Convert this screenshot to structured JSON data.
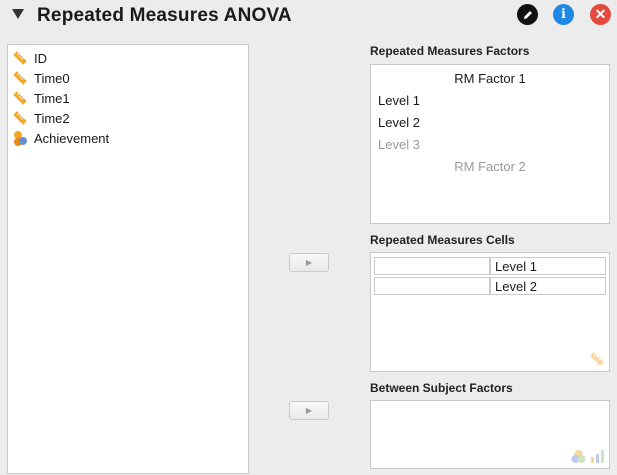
{
  "header": {
    "title": "Repeated Measures ANOVA",
    "buttons": [
      {
        "name": "edit-title",
        "icon": "pencil-icon",
        "color": "#111111"
      },
      {
        "name": "info",
        "icon": "info-icon",
        "color": "#1e88e5"
      },
      {
        "name": "close",
        "icon": "close-icon",
        "color": "#e4493d"
      }
    ]
  },
  "variables": [
    {
      "label": "ID",
      "icon": "scale-ruler-icon"
    },
    {
      "label": "Time0",
      "icon": "scale-ruler-icon"
    },
    {
      "label": "Time1",
      "icon": "scale-ruler-icon"
    },
    {
      "label": "Time2",
      "icon": "scale-ruler-icon"
    },
    {
      "label": "Achievement",
      "icon": "nominal-variable-icon"
    }
  ],
  "rm_factors": {
    "label": "Repeated Measures Factors",
    "factor1": "RM Factor 1",
    "levels": [
      "Level 1",
      "Level 2"
    ],
    "level_placeholder": "Level 3",
    "factor2_placeholder": "RM Factor 2"
  },
  "rm_cells": {
    "label": "Repeated Measures Cells",
    "rows": [
      {
        "variable": "",
        "level": "Level 1"
      },
      {
        "variable": "",
        "level": "Level 2"
      }
    ]
  },
  "between_subject": {
    "label": "Between Subject Factors"
  },
  "colors": {
    "accent_info": "#1e88e5",
    "close": "#e4493d",
    "scale_icon": "#f5a623"
  }
}
